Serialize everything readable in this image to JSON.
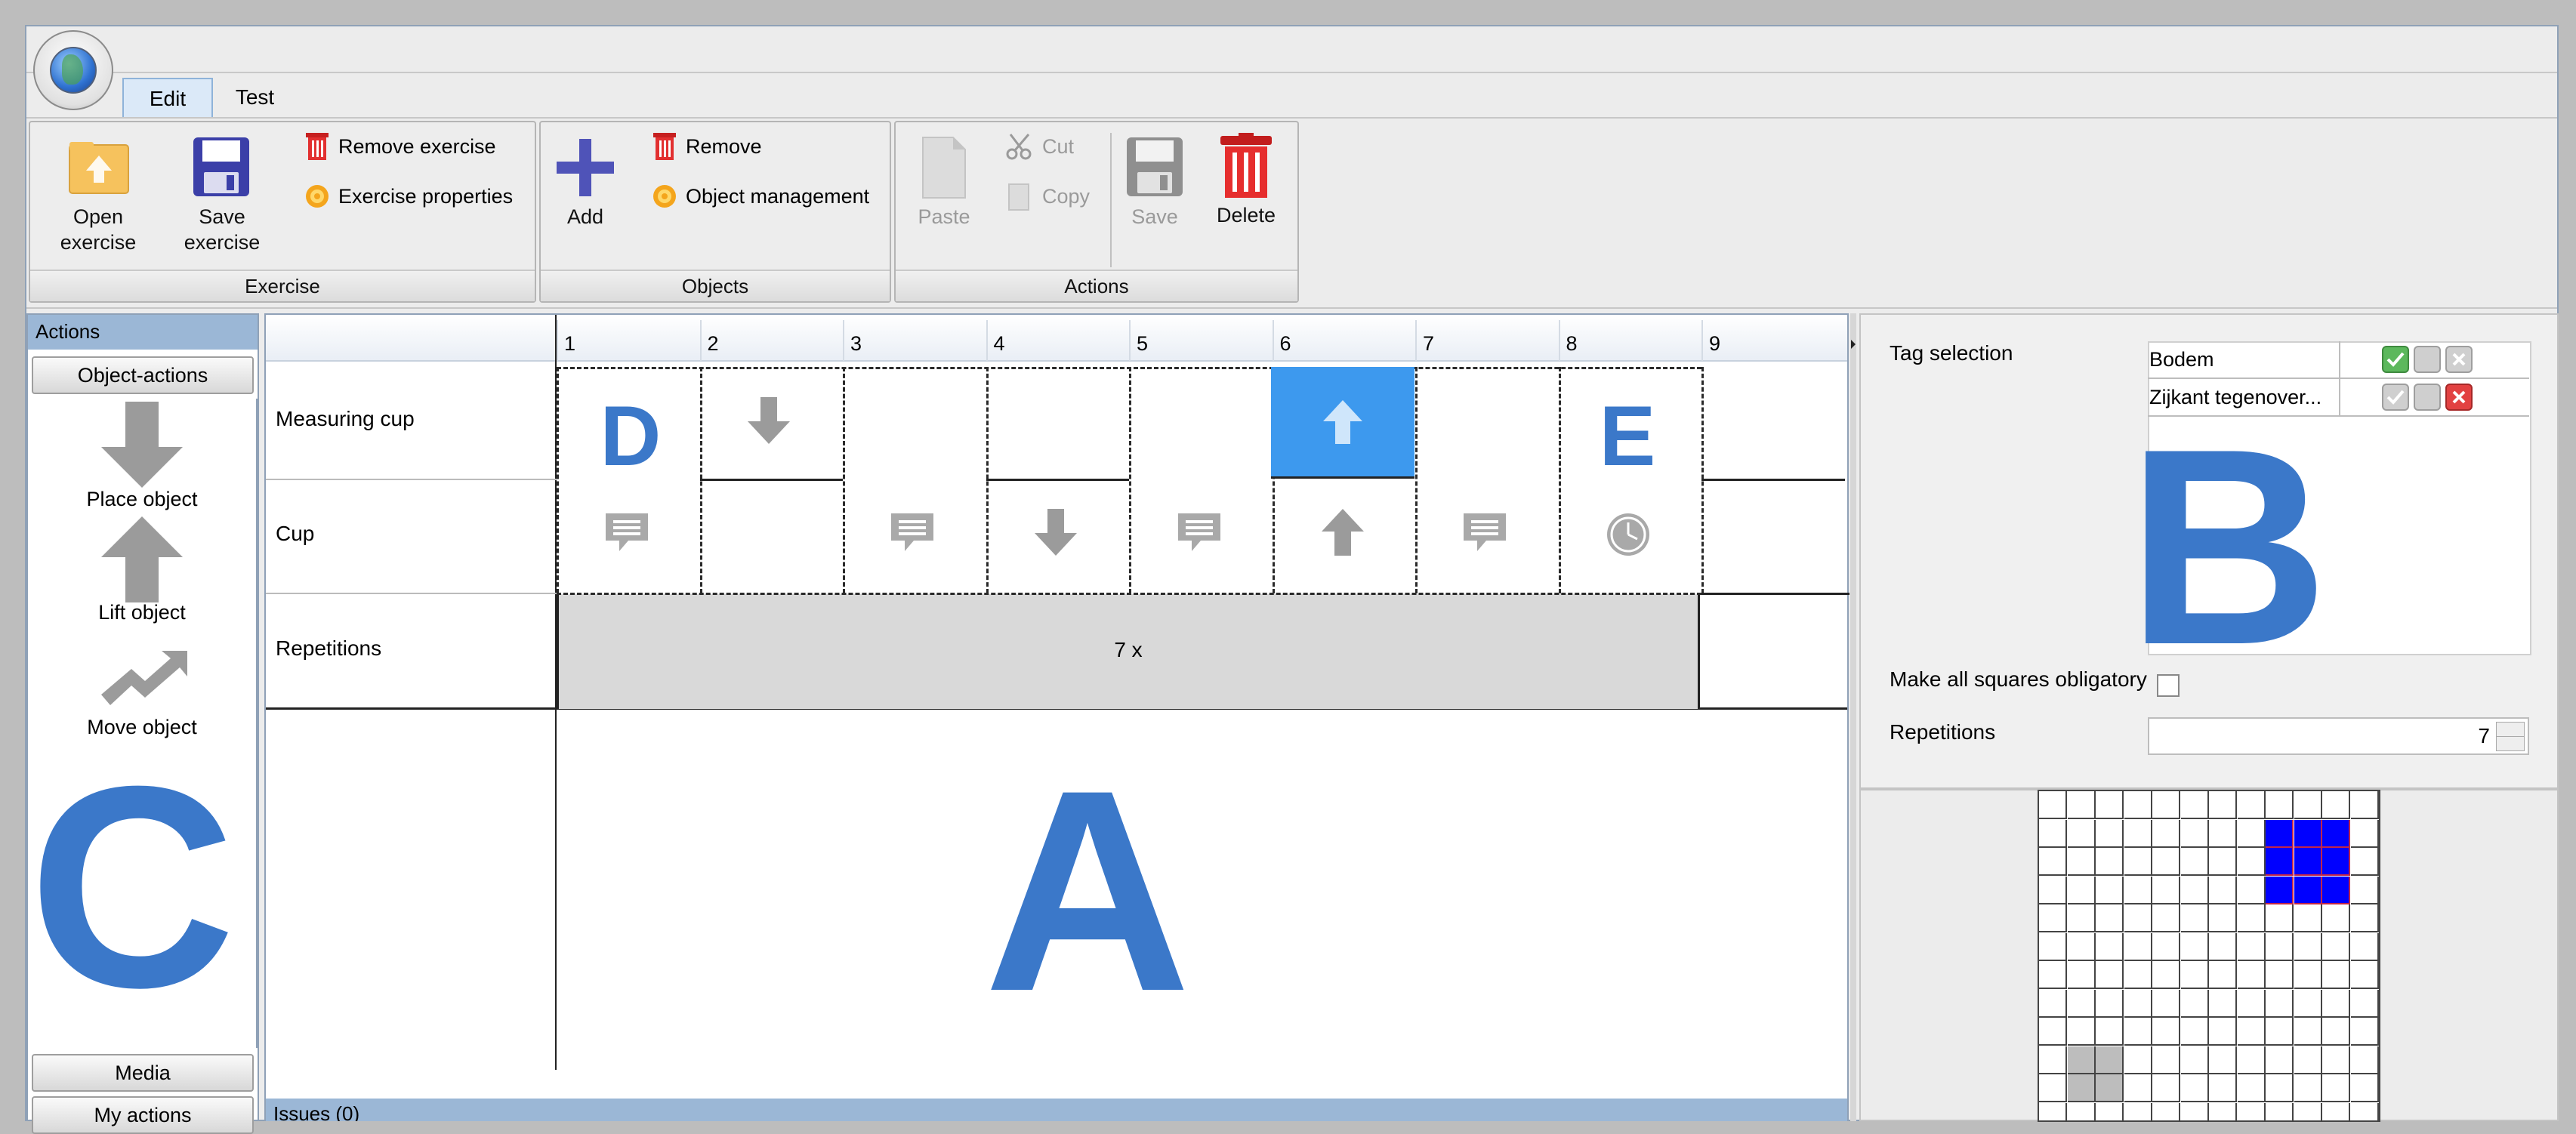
{
  "tabs": {
    "edit": "Edit",
    "test": "Test"
  },
  "ribbon": {
    "exercise": {
      "label": "Exercise",
      "open": [
        "Open",
        "exercise"
      ],
      "save": [
        "Save",
        "exercise"
      ],
      "remove": "Remove exercise",
      "properties": "Exercise properties"
    },
    "objects": {
      "label": "Objects",
      "add": "Add",
      "remove": "Remove",
      "management": "Object management"
    },
    "actions": {
      "label": "Actions",
      "paste": "Paste",
      "cut": "Cut",
      "copy": "Copy",
      "save": "Save",
      "delete": "Delete"
    }
  },
  "left_panel": {
    "header": "Actions",
    "section_object_actions": "Object-actions",
    "items": [
      {
        "label": "Place object",
        "icon": "arrow-down-icon"
      },
      {
        "label": "Lift object",
        "icon": "arrow-up-icon"
      },
      {
        "label": "Move object",
        "icon": "move-arrow-icon"
      }
    ],
    "media": "Media",
    "my_actions": "My actions"
  },
  "timeline": {
    "columns": [
      "1",
      "2",
      "3",
      "4",
      "5",
      "6",
      "7",
      "8",
      "9"
    ],
    "rows": [
      "Measuring cup",
      "Cup",
      "Repetitions"
    ],
    "repetitions_text": "7 x",
    "issues": "Issues (0)"
  },
  "right_panel": {
    "tag_selection_label": "Tag selection",
    "tags": [
      "Bodem",
      "Zijkant tegenover..."
    ],
    "obligatory_label": "Make all squares obligatory",
    "repetitions_label": "Repetitions",
    "repetitions_value": "7"
  },
  "overlay_letters": {
    "a": "A",
    "b": "B",
    "c": "C",
    "d": "D",
    "e": "E"
  },
  "colors": {
    "accent_blue": "#3b78c9",
    "selected_cell": "#3d99ee",
    "grid_fill": "#0000ff",
    "panel_header": "#9bb7d6"
  }
}
